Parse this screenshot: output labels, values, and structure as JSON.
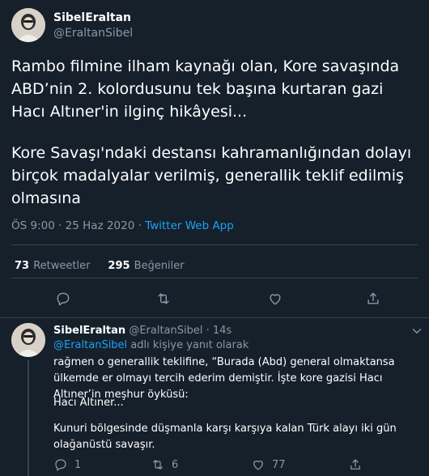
{
  "tweet": {
    "author": {
      "name": "SibelEraltan",
      "handle": "@EraltanSibel"
    },
    "text_part1": "Rambo filmine ilham kaynağı olan, Kore savaşında ABD’nin 2. kolordusunu tek başına kurtaran gazi Hacı Altıner'in ilginç hikâyesi...",
    "text_part2": "Kore Savaşı'ndaki destansı kahramanlığından dolayı birçok madalyalar verilmiş, generallik teklif edilmiş olmasına",
    "time": "ÖS 9:00 · 25 Haz 2020 ·",
    "source": "Twitter Web App",
    "stats": {
      "retweets_count": "73",
      "retweets_label": "Retweetler",
      "likes_count": "295",
      "likes_label": "Beğeniler"
    },
    "icons": [
      "reply-icon",
      "retweet-icon",
      "like-icon",
      "share-icon"
    ]
  },
  "reply": {
    "author": {
      "name": "SibelEraltan",
      "handle": "@EraltanSibel",
      "time": "· 14s"
    },
    "replying_to_mention": "@EraltanSibel",
    "replying_to_suffix": "adlı kişiye yanıt olarak",
    "paragraph1": "rağmen o generallik teklifine, “Burada (Abd) general olmaktansa ülkemde er olmayı tercih ederim demiştir. İşte kore gazisi Hacı Altıner’in meşhur öyküsü:",
    "paragraph2": "Hacı Altıner...",
    "paragraph3": "Kunuri bölgesinde düşmanla karşı karşıya kalan Türk alayı iki gün olağanüstü savaşır.",
    "actions": {
      "reply_count": "1",
      "retweet_count": "6",
      "like_count": "77"
    }
  }
}
